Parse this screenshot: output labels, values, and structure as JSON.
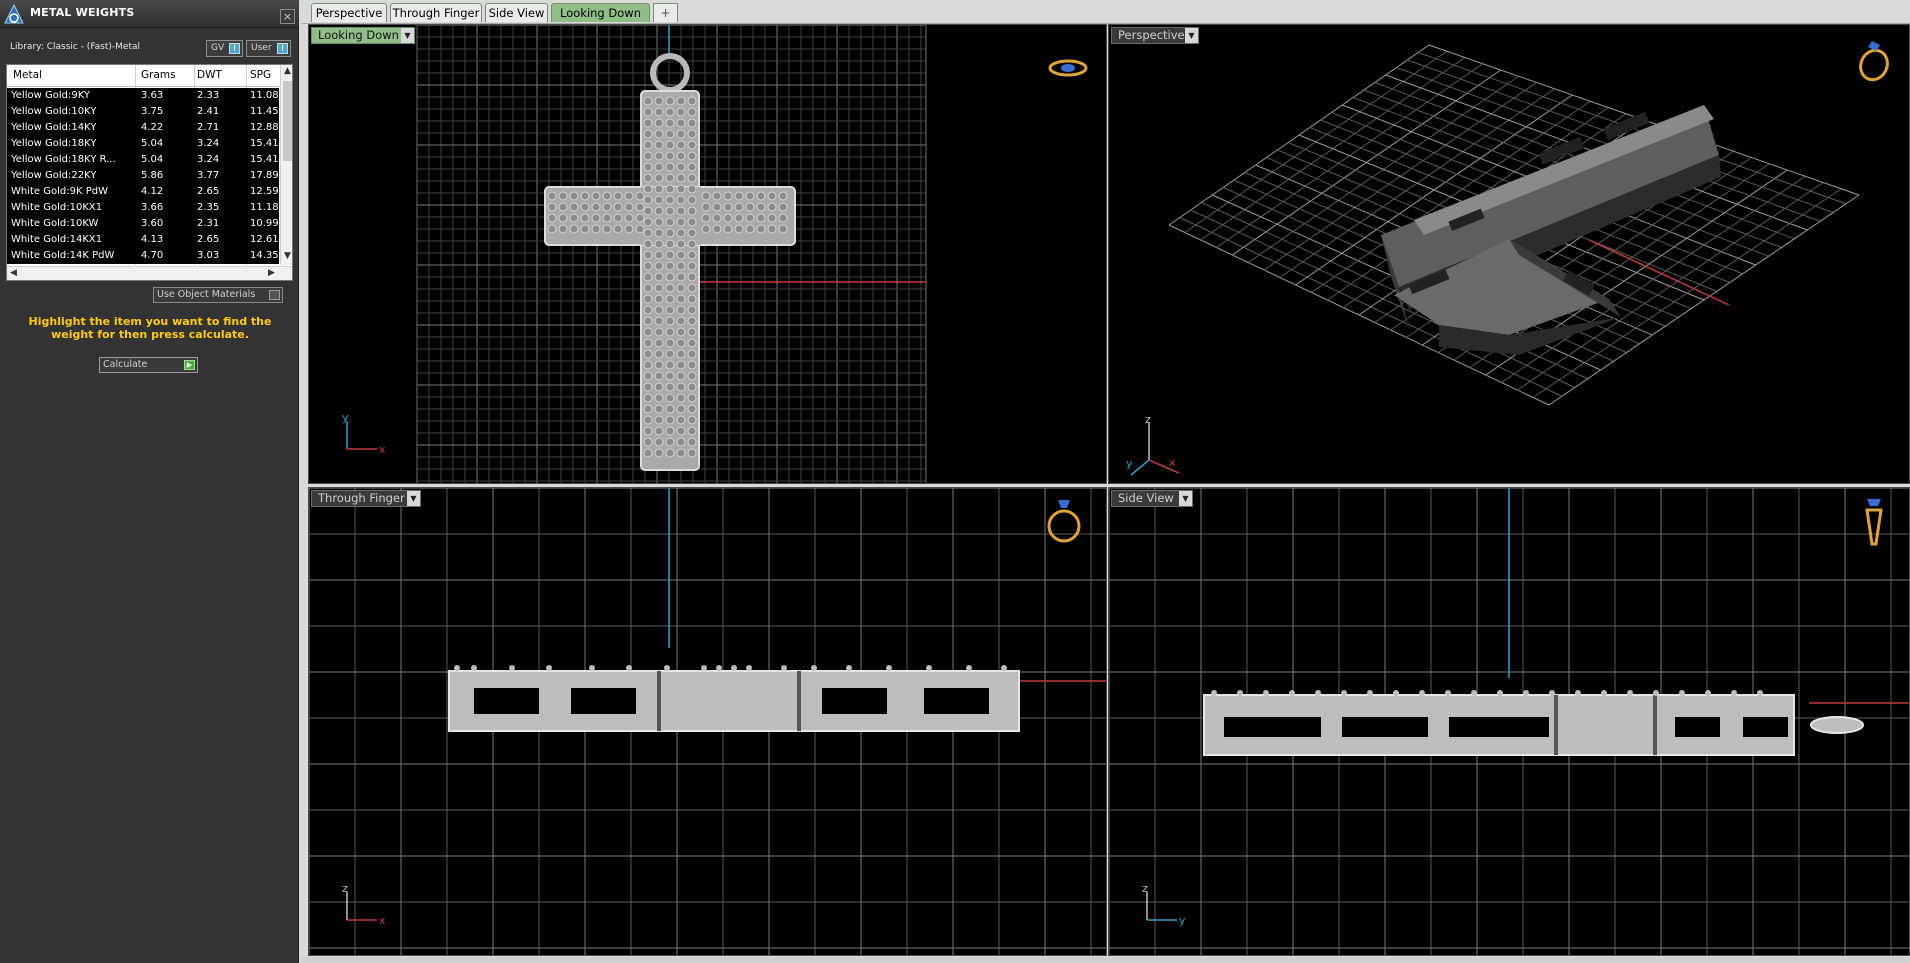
{
  "panel": {
    "title": "METAL WEIGHTS",
    "close": "×",
    "library_label": "Library: Classic - (Fast)-Metal",
    "gv_label": "GV",
    "user_label": "User",
    "toggle_glyph": "I",
    "columns": [
      "Metal",
      "Grams",
      "DWT",
      "SPG"
    ],
    "rows": [
      {
        "metal": "Yellow Gold:9KY",
        "grams": "3.63",
        "dwt": "2.33",
        "spg": "11.08"
      },
      {
        "metal": "Yellow Gold:10KY",
        "grams": "3.75",
        "dwt": "2.41",
        "spg": "11.45"
      },
      {
        "metal": "Yellow Gold:14KY",
        "grams": "4.22",
        "dwt": "2.71",
        "spg": "12.88"
      },
      {
        "metal": "Yellow Gold:18KY",
        "grams": "5.04",
        "dwt": "3.24",
        "spg": "15.41"
      },
      {
        "metal": "Yellow Gold:18KY R...",
        "grams": "5.04",
        "dwt": "3.24",
        "spg": "15.41"
      },
      {
        "metal": "Yellow Gold:22KY",
        "grams": "5.86",
        "dwt": "3.77",
        "spg": "17.89"
      },
      {
        "metal": "White Gold:9K PdW",
        "grams": "4.12",
        "dwt": "2.65",
        "spg": "12.59"
      },
      {
        "metal": "White Gold:10KX1",
        "grams": "3.66",
        "dwt": "2.35",
        "spg": "11.18"
      },
      {
        "metal": "White Gold:10KW",
        "grams": "3.60",
        "dwt": "2.31",
        "spg": "10.99"
      },
      {
        "metal": "White Gold:14KX1",
        "grams": "4.13",
        "dwt": "2.65",
        "spg": "12.61"
      },
      {
        "metal": "White Gold:14K PdW",
        "grams": "4.70",
        "dwt": "3.03",
        "spg": "14.35"
      }
    ],
    "use_object_materials": "Use Object Materials",
    "hint": "Highlight the item you want to find the weight for then press calculate.",
    "calculate": "Calculate"
  },
  "tabs": [
    {
      "label": "Perspective",
      "active": false
    },
    {
      "label": "Through Finger",
      "active": false
    },
    {
      "label": "Side View",
      "active": false
    },
    {
      "label": "Looking Down",
      "active": true
    }
  ],
  "add_tab": "+",
  "viewports": {
    "top_left": {
      "label": "Looking Down",
      "axis_a": "y",
      "axis_b": "x"
    },
    "top_right": {
      "label": "Perspective",
      "axis_a": "z",
      "axis_b": "x",
      "axis_c": "y"
    },
    "bottom_left": {
      "label": "Through Finger",
      "axis_a": "z",
      "axis_b": "x"
    },
    "bottom_right": {
      "label": "Side View",
      "axis_a": "z",
      "axis_b": "y"
    }
  },
  "dropdown_glyph": "▼",
  "colors": {
    "grid": "#5e5e5e",
    "axis_red": "#c23b3b",
    "axis_cyan": "#2fa3c2",
    "metal": "#b9b9b9",
    "hint_yellow": "#ffcc00",
    "active_tab": "#8fbf86"
  },
  "icons": {
    "panel_logo": "metal-weights-logo-icon",
    "view_ring_down": "ring-top-view-icon",
    "view_ring_persp": "ring-perspective-icon",
    "view_ring_finger": "ring-front-view-icon",
    "view_ring_side": "ring-side-view-icon"
  }
}
